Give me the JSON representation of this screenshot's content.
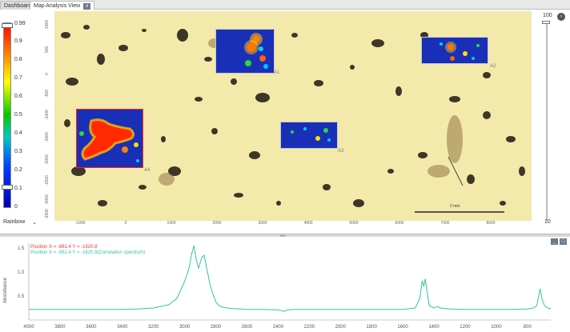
{
  "tabs": [
    {
      "label": "Dashboard",
      "active": false
    },
    {
      "label": "Map Analysis View",
      "active": true,
      "close": "x"
    }
  ],
  "colorbar": {
    "labels": [
      "0.99",
      "0.9",
      "0.8",
      "0.7",
      "0.6",
      "0.5",
      "0.4",
      "0.3",
      "0.2",
      "0.1",
      "0"
    ],
    "palette": "Rainbow"
  },
  "map": {
    "y_ticks": [
      "1500",
      "500",
      "0",
      "-500",
      "-1000",
      "-1500",
      "-2000",
      "-2500",
      "-3000",
      "-3500"
    ],
    "x_ticks": [
      "-1000",
      "0",
      "1000",
      "2000",
      "3000",
      "4000",
      "5000",
      "6000",
      "7000",
      "8000"
    ],
    "scale_label": "2 mm",
    "overlays": [
      {
        "label": "A1"
      },
      {
        "label": "A2"
      },
      {
        "label": "A3"
      },
      {
        "label": "A4"
      }
    ]
  },
  "right_slider": {
    "top": "100",
    "bottom": "10",
    "arrow": "›"
  },
  "spectrum": {
    "legend": [
      {
        "text": "Position X = -861.4 Y = -1620.8",
        "color": "#ff3030"
      },
      {
        "text": "Position X = -861.4 Y = -1620.8(Correlation spectrum)",
        "color": "#33c4a0"
      }
    ],
    "ylabel": "Absorbance",
    "y_ticks": [
      "1.5",
      "1.0",
      "0.5"
    ],
    "x_ticks": [
      "4000",
      "3800",
      "3600",
      "3400",
      "3200",
      "3000",
      "2800",
      "2600",
      "2400",
      "2200",
      "2000",
      "1800",
      "1600",
      "1400",
      "1200",
      "1000",
      "800"
    ],
    "minimize": "_",
    "maximize": "□"
  },
  "chart_data": {
    "type": "line",
    "title": "",
    "xlabel": "",
    "ylabel": "Absorbance",
    "xlim": [
      4000,
      650
    ],
    "ylim": [
      0,
      1.6
    ],
    "series": [
      {
        "name": "Position X = -861.4 Y = -1620.8(Correlation spectrum)",
        "color": "#33c4a0",
        "x": [
          4000,
          3800,
          3600,
          3400,
          3300,
          3200,
          3100,
          3050,
          3000,
          2970,
          2955,
          2940,
          2925,
          2910,
          2890,
          2875,
          2860,
          2850,
          2840,
          2820,
          2800,
          2780,
          2750,
          2700,
          2600,
          2500,
          2400,
          2360,
          2340,
          2300,
          2200,
          2000,
          1800,
          1700,
          1600,
          1520,
          1490,
          1475,
          1465,
          1455,
          1445,
          1430,
          1400,
          1377,
          1360,
          1300,
          1200,
          1100,
          1000,
          900,
          800,
          760,
          740,
          725,
          718,
          705,
          690,
          670,
          650
        ],
        "y": [
          0.22,
          0.22,
          0.22,
          0.22,
          0.23,
          0.25,
          0.32,
          0.45,
          0.8,
          1.1,
          1.38,
          1.55,
          1.25,
          1.08,
          1.3,
          1.35,
          1.1,
          0.95,
          0.78,
          0.55,
          0.38,
          0.3,
          0.26,
          0.24,
          0.22,
          0.22,
          0.21,
          0.18,
          0.21,
          0.22,
          0.22,
          0.22,
          0.22,
          0.22,
          0.22,
          0.25,
          0.45,
          0.82,
          0.7,
          0.86,
          0.6,
          0.3,
          0.25,
          0.28,
          0.25,
          0.23,
          0.22,
          0.22,
          0.22,
          0.22,
          0.23,
          0.25,
          0.3,
          0.55,
          0.65,
          0.42,
          0.3,
          0.25,
          0.24
        ]
      }
    ],
    "grid": false
  }
}
